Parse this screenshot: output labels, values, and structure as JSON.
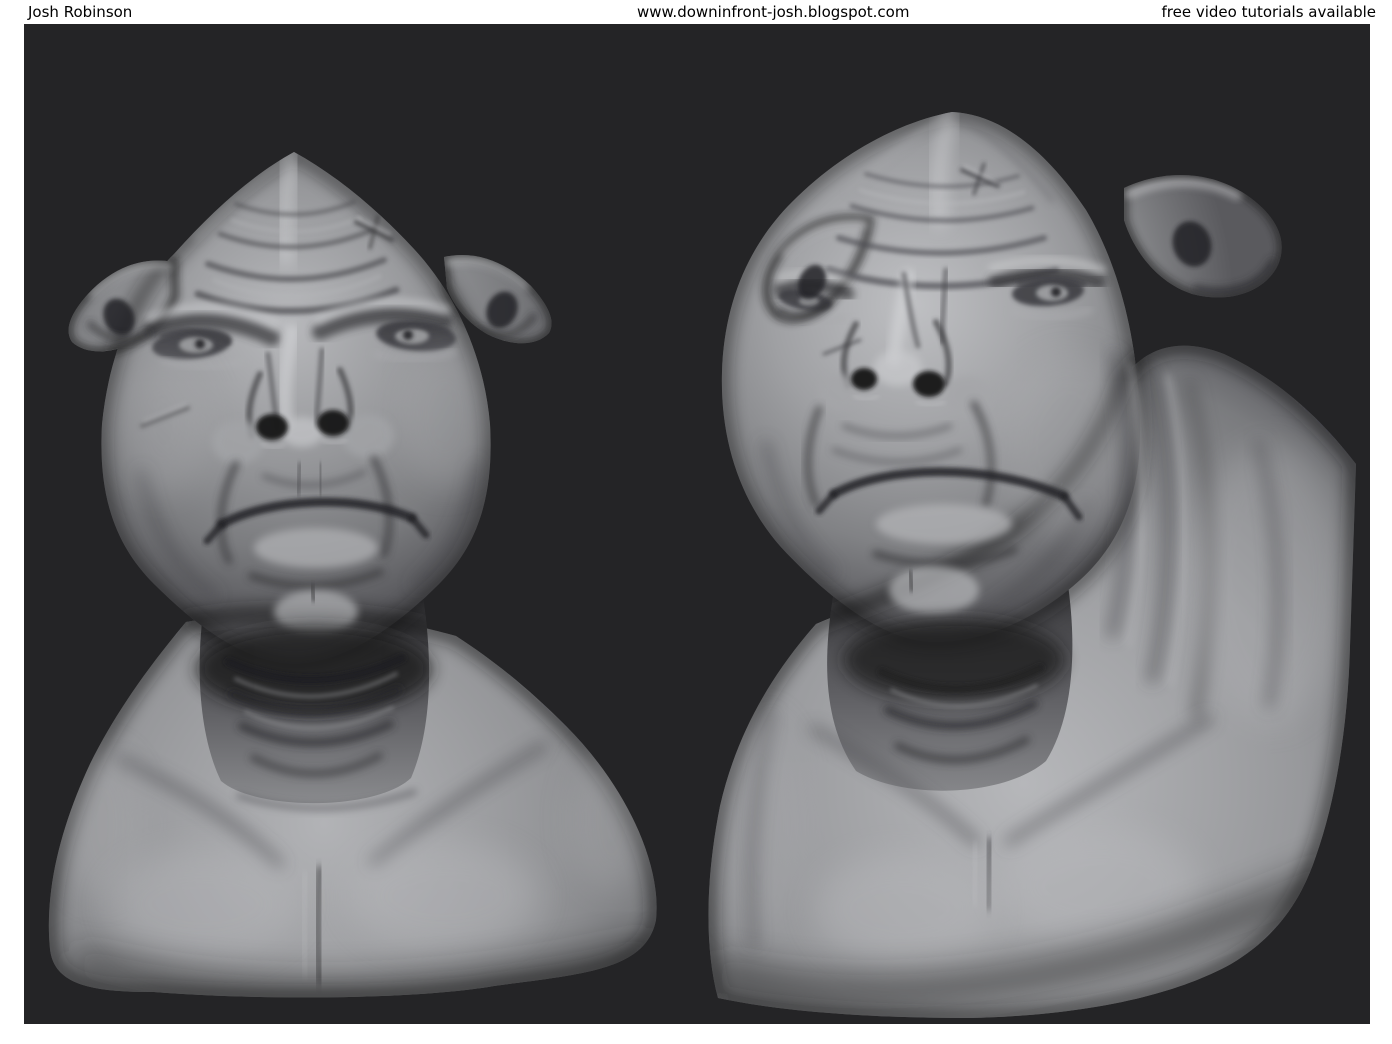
{
  "header": {
    "artist": "Josh Robinson",
    "website": "www.downinfront-josh.blogspot.com",
    "note": "free video tutorials available"
  },
  "colors": {
    "page_bg": "#ffffff",
    "canvas_bg": "#242426",
    "header_text": "#000000",
    "sculpt_light": "#c9cacc",
    "sculpt_mid": "#8f9093",
    "sculpt_dark": "#3c3c3f",
    "crease": "#1a1a1c"
  }
}
